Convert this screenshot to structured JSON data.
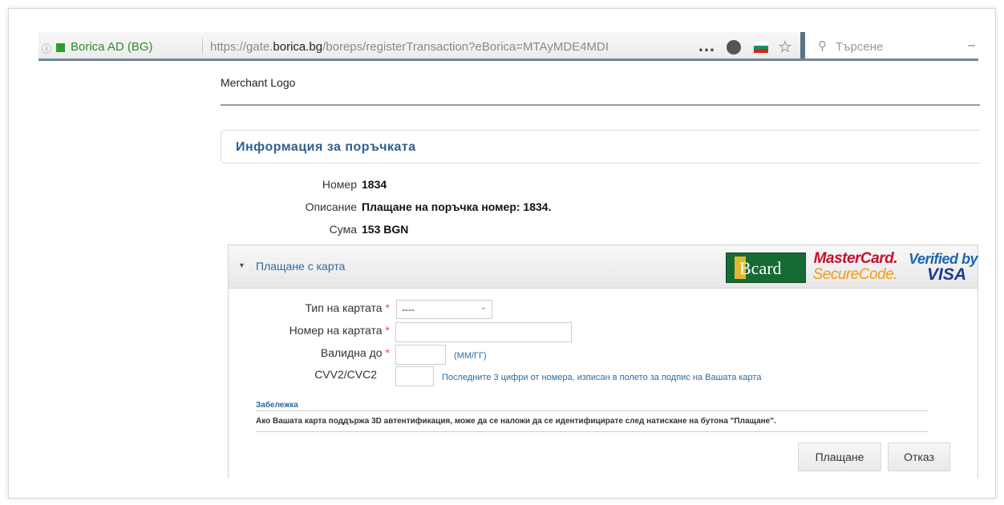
{
  "browser": {
    "site_identity": "Borica AD (BG)",
    "url_prefix": "https://gate.",
    "url_domain": "borica.bg",
    "url_rest": "/boreps/registerTransaction?eBorica=MTAyMDE4MDI",
    "more_icon": "…",
    "search_placeholder": "Търсене"
  },
  "merchant_logo": "Merchant Logo",
  "order": {
    "title": "Информация за поръчката",
    "number_label": "Номер",
    "number_value": "1834",
    "description_label": "Описание",
    "description_value": "Плащане на поръчка номер: 1834.",
    "amount_label": "Сума",
    "amount_value": "153 BGN"
  },
  "payment": {
    "section_title": "Плащане с карта",
    "logos": {
      "bcard": "Bcard",
      "mastercard_line1": "MasterCard.",
      "mastercard_line2": "SecureCode.",
      "visa_line1": "Verified by",
      "visa_line2": "VISA"
    },
    "card_type_label": "Тип на картата",
    "card_type_value": "----",
    "card_number_label": "Номер на картата",
    "valid_label": "Валидна до",
    "valid_hint": "(ММ/ГГ)",
    "cvv_label": "CVV2/CVC2",
    "cvv_hint": "Последните 3 цифри от номера, изписан в полето за подпис на Вашата карта",
    "required_mark": "*",
    "note_title": "Забележка",
    "note_text": "Ако Вашата карта поддържа 3D автентификация, може да се наложи да се идентифицирате след натискане на бутона \"Плащане\".",
    "pay_button": "Плащане",
    "cancel_button": "Отказ"
  },
  "colors": {
    "link_blue": "#2f6aa0",
    "title_blue": "#2f5f8f",
    "required_red": "#d9534f",
    "bcard_green": "#166b35",
    "mastercard_red": "#c8102e",
    "mastercard_orange": "#f39c12",
    "visa_blue": "#1a3e8c"
  }
}
